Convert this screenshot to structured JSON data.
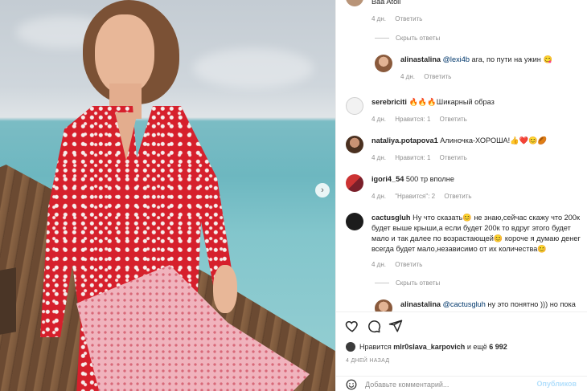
{
  "photo": {
    "alt_present": false
  },
  "comments": [
    {
      "username": "",
      "text": "Baa Atoll",
      "age": "4 дн.",
      "reply": "Ответить"
    },
    {
      "hide_replies": "Скрыть ответы"
    },
    {
      "username": "alinastalina",
      "mention": "@lexi4b",
      "text": "ага, по пути на ужин",
      "emoji": "😋",
      "age": "4 дн.",
      "reply": "Ответить"
    },
    {
      "username": "serebriciti",
      "text": "🔥🔥🔥Шикарный образ",
      "age": "4 дн.",
      "likes": "Нравится: 1",
      "reply": "Ответить"
    },
    {
      "username": "nataliya.potapova1",
      "text": "Алиночка-ХОРОША!👍❤️😊🏉",
      "age": "4 дн.",
      "likes": "Нравится: 1",
      "reply": "Ответить"
    },
    {
      "username": "igori4_54",
      "text": "500 тр вполне",
      "age": "4 дн.",
      "likes": "\"Нравится\": 2",
      "reply": "Ответить"
    },
    {
      "username": "cactusgluh",
      "text_lines": [
        "Ну что сказать😊 не знаю,сейчас скажу что 200к",
        "будет выше крыши,а если будет 200к то вдруг этого будет",
        "мало и так далее по возрастающей😊 короче я думаю денег",
        "всегда будет мало,независимо от их количества😊"
      ],
      "age": "4 дн.",
      "reply": "Ответить"
    },
    {
      "hide_replies": "Скрыть ответы"
    },
    {
      "username": "alinastalina",
      "mention": "@cactusgluh",
      "text": "ну это понятно ))) но пока"
    }
  ],
  "actions": {
    "like_icon": "heart-icon",
    "comment_icon": "comment-icon",
    "share_icon": "send-icon"
  },
  "likes": {
    "prefix": "Нравится",
    "user": "mlr0slava_karpovich",
    "middle": "и ещё",
    "count": "6 992"
  },
  "post_date": "4 ДНЕЙ НАЗАД",
  "add_comment": {
    "placeholder": "Добавьте комментарий...",
    "publish_label": "Опубликов",
    "emoji_icon": "smile-icon"
  },
  "colors": {
    "link_blue": "#00376b",
    "publish_disabled": "#b2dffc",
    "meta_gray": "#8e8e8e"
  }
}
